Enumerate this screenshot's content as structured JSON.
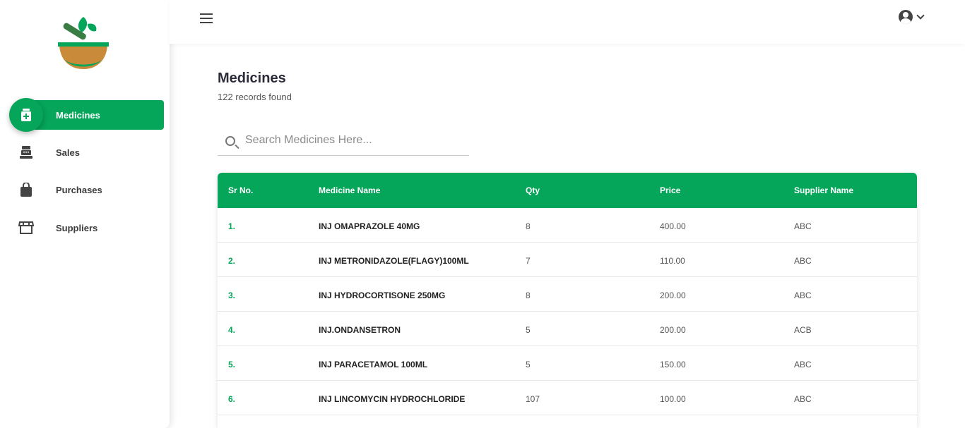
{
  "sidebar": {
    "logo_name": "mortar-and-pestle-logo",
    "items": [
      {
        "label": "Medicines",
        "icon": "medicine-bottle-icon",
        "active": true
      },
      {
        "label": "Sales",
        "icon": "cash-register-icon",
        "active": false
      },
      {
        "label": "Purchases",
        "icon": "shopping-bag-icon",
        "active": false
      },
      {
        "label": "Suppliers",
        "icon": "storefront-icon",
        "active": false
      }
    ]
  },
  "topbar": {
    "menu_icon": "hamburger-icon",
    "user_icon": "account-circle-icon",
    "dropdown_icon": "chevron-down-icon"
  },
  "page": {
    "title": "Medicines",
    "record_count": "122 records found"
  },
  "search": {
    "placeholder": "Search Medicines Here...",
    "value": ""
  },
  "table": {
    "headers": [
      "Sr No.",
      "Medicine Name",
      "Qty",
      "Price",
      "Supplier Name"
    ],
    "rows": [
      {
        "sr": "1.",
        "name": "INJ OMAPRAZOLE 40MG",
        "qty": "8",
        "price": "400.00",
        "supplier": "ABC"
      },
      {
        "sr": "2.",
        "name": "INJ METRONIDAZOLE(FLAGY)100ML",
        "qty": "7",
        "price": "110.00",
        "supplier": "ABC"
      },
      {
        "sr": "3.",
        "name": "INJ HYDROCORTISONE 250MG",
        "qty": "8",
        "price": "200.00",
        "supplier": "ABC"
      },
      {
        "sr": "4.",
        "name": "INJ.ONDANSETRON",
        "qty": "5",
        "price": "200.00",
        "supplier": "ACB"
      },
      {
        "sr": "5.",
        "name": "INJ PARACETAMOL 100ML",
        "qty": "5",
        "price": "150.00",
        "supplier": "ABC"
      },
      {
        "sr": "6.",
        "name": "INJ LINCOMYCIN HYDROCHLORIDE",
        "qty": "107",
        "price": "100.00",
        "supplier": "ABC"
      }
    ]
  },
  "colors": {
    "accent": "#05a55a",
    "text": "#2b2b3a"
  }
}
